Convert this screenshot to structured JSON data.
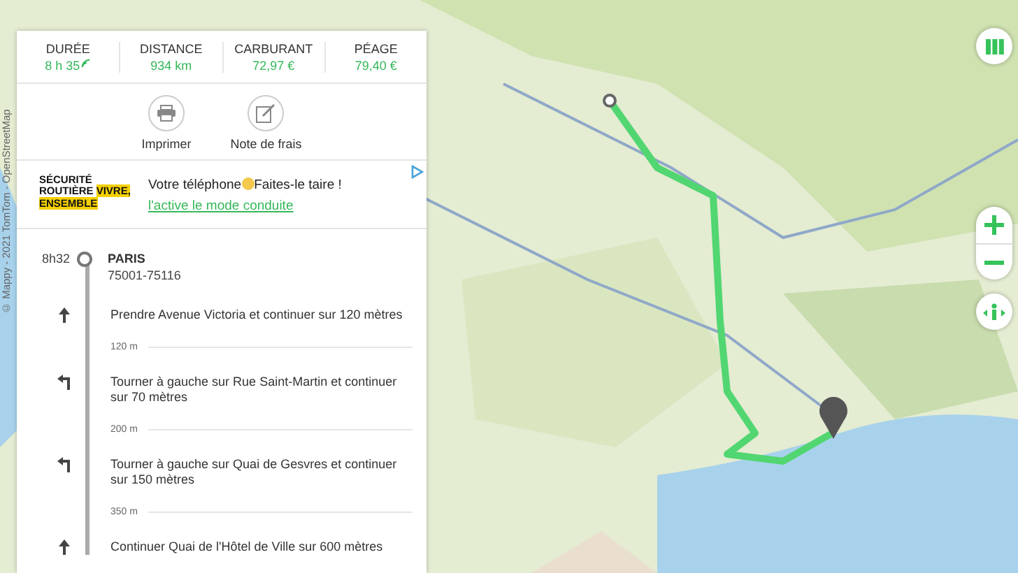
{
  "map": {
    "attribution": "© Mappy - 2021 TomTom - OpenStreetMap"
  },
  "summary": [
    {
      "label": "DURÉE",
      "value": "8 h 35",
      "kind": "live"
    },
    {
      "label": "DISTANCE",
      "value": "934 km",
      "kind": "plain"
    },
    {
      "label": "CARBURANT",
      "value": "72,97 €",
      "kind": "plain"
    },
    {
      "label": "PÉAGE",
      "value": "79,40 €",
      "kind": "plain"
    }
  ],
  "actions": [
    {
      "label": "Imprimer",
      "kind": "print"
    },
    {
      "label": "Note de frais",
      "kind": "expense"
    }
  ],
  "ad": {
    "logo_line_1": "SÉCURITÉ",
    "logo_line_2": "ROUTIÈRE",
    "logo_highlight_1": "VIVRE,",
    "logo_highlight_2": "ENSEMBLE",
    "text_before": "Votre téléphone",
    "text_after": "Faites-le taire ! ",
    "link": "l'active le mode conduite"
  },
  "itinerary": {
    "start": {
      "time": "8h32",
      "title": "PARIS",
      "subtitle": "75001-75116"
    },
    "steps": [
      {
        "kind": "straight",
        "text": "Prendre Avenue Victoria et continuer sur 120 mètres",
        "distance_after": "120 m"
      },
      {
        "kind": "left",
        "text": "Tourner à gauche sur Rue Saint-Martin et continuer sur 70 mètres",
        "distance_after": "200 m"
      },
      {
        "kind": "left",
        "text": "Tourner à gauche sur Quai de Gesvres et continuer sur 150 mètres",
        "distance_after": "350 m"
      },
      {
        "kind": "straight",
        "text": "Continuer Quai de l'Hôtel de Ville sur 600 mètres"
      }
    ]
  }
}
